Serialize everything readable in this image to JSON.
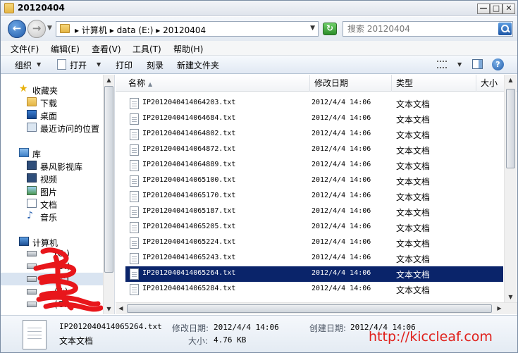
{
  "window": {
    "title": "20120404",
    "controls": {
      "minimize": "—",
      "maximize": "□",
      "close": "✕"
    }
  },
  "address": {
    "crumbs": [
      "计算机",
      "data (E:)",
      "20120404"
    ],
    "separator": "▸"
  },
  "search": {
    "placeholder": "搜索 20120404"
  },
  "menu": [
    "文件(F)",
    "编辑(E)",
    "查看(V)",
    "工具(T)",
    "帮助(H)"
  ],
  "commands": {
    "organize": "组织",
    "open": "打开",
    "print": "打印",
    "burn": "刻录",
    "new_folder": "新建文件夹"
  },
  "nav": {
    "favorites": {
      "label": "收藏夹",
      "items": [
        "下载",
        "桌面",
        "最近访问的位置"
      ]
    },
    "libraries": {
      "label": "库",
      "items": [
        "暴风影视库",
        "视频",
        "图片",
        "文档",
        "音乐"
      ]
    },
    "computer": {
      "label": "计算机",
      "drives": [
        "(C:)",
        "(D:)",
        "(E:)",
        "(F:)",
        "(G:)"
      ],
      "selected_drive_index": 2
    }
  },
  "columns": {
    "name": "名称",
    "date": "修改日期",
    "type": "类型",
    "size": "大小"
  },
  "files": [
    {
      "name": "IP2012040414064203.txt",
      "date": "2012/4/4 14:06",
      "type": "文本文档"
    },
    {
      "name": "IP2012040414064684.txt",
      "date": "2012/4/4 14:06",
      "type": "文本文档"
    },
    {
      "name": "IP2012040414064802.txt",
      "date": "2012/4/4 14:06",
      "type": "文本文档"
    },
    {
      "name": "IP2012040414064872.txt",
      "date": "2012/4/4 14:06",
      "type": "文本文档"
    },
    {
      "name": "IP2012040414064889.txt",
      "date": "2012/4/4 14:06",
      "type": "文本文档"
    },
    {
      "name": "IP2012040414065100.txt",
      "date": "2012/4/4 14:06",
      "type": "文本文档"
    },
    {
      "name": "IP2012040414065170.txt",
      "date": "2012/4/4 14:06",
      "type": "文本文档"
    },
    {
      "name": "IP2012040414065187.txt",
      "date": "2012/4/4 14:06",
      "type": "文本文档"
    },
    {
      "name": "IP2012040414065205.txt",
      "date": "2012/4/4 14:06",
      "type": "文本文档"
    },
    {
      "name": "IP2012040414065224.txt",
      "date": "2012/4/4 14:06",
      "type": "文本文档"
    },
    {
      "name": "IP2012040414065243.txt",
      "date": "2012/4/4 14:06",
      "type": "文本文档"
    },
    {
      "name": "IP2012040414065264.txt",
      "date": "2012/4/4 14:06",
      "type": "文本文档"
    },
    {
      "name": "IP2012040414065284.txt",
      "date": "2012/4/4 14:06",
      "type": "文本文档"
    }
  ],
  "selected_file_index": 11,
  "details": {
    "filename": "IP2012040414065264.txt",
    "type": "文本文档",
    "modified_label": "修改日期:",
    "modified_value": "2012/4/4 14:06",
    "created_label": "创建日期:",
    "created_value": "2012/4/4 14:06",
    "size_label": "大小:",
    "size_value": "4.76 KB"
  },
  "watermark": "http://kiccleaf.com",
  "colors": {
    "selection": "#0a246a",
    "watermark": "#e0201b",
    "scribble": "#e8161b"
  }
}
